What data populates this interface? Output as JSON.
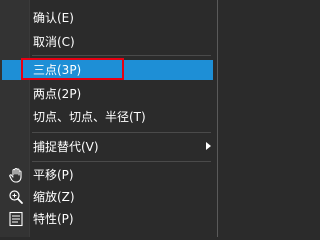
{
  "menu": {
    "items": [
      {
        "label": "确认(E)"
      },
      {
        "label": "取消(C)"
      },
      {
        "label": "三点(3P)"
      },
      {
        "label": "两点(2P)"
      },
      {
        "label": "切点、切点、半径(T)"
      },
      {
        "label": "捕捉替代(V)"
      },
      {
        "label": "平移(P)",
        "icon": "hand-pan-icon"
      },
      {
        "label": "缩放(Z)",
        "icon": "zoom-icon"
      },
      {
        "label": "特性(P)",
        "icon": "properties-icon"
      }
    ],
    "selected_index": 2,
    "colors": {
      "background": "#2b2b2b",
      "selection": "#1e8fd6",
      "highlight_box": "#e60012",
      "text": "#ffffff"
    }
  }
}
